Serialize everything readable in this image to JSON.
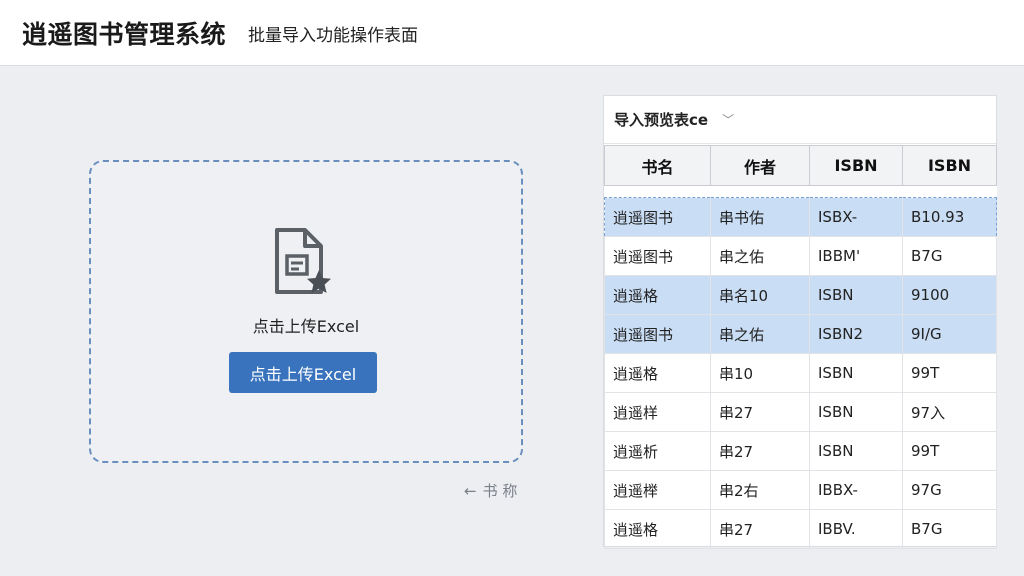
{
  "header": {
    "app_title": "逍遥图书管理系统",
    "page_subtitle": "批量导入功能操作表面"
  },
  "upload": {
    "instruction": "点击上传Excel",
    "button_label": "点击上传Excel",
    "back_hint": "书 称",
    "icon": "document-star-icon"
  },
  "preview": {
    "select_label": "导入预览表ce",
    "columns": [
      "书名",
      "作者",
      "ISBN",
      "ISBN"
    ],
    "rows": [
      [
        "逍遥图书",
        "串书佑",
        "ISBX-",
        "B10.93"
      ],
      [
        "逍遥图书",
        "串之佑",
        "IBBM'",
        "B7G"
      ],
      [
        "逍遥格",
        "串名10",
        "ISBN",
        "9100"
      ],
      [
        "逍遥图书",
        "串之佑",
        "ISBN2",
        "9I/G"
      ],
      [
        "逍遥格",
        "串10",
        "ISBN",
        "99T"
      ],
      [
        "逍遥样",
        "串27",
        "ISBN",
        "97入"
      ],
      [
        "逍遥析",
        "串27",
        "ISBN",
        "99T"
      ],
      [
        "逍遥榉",
        "串2右",
        "IBBX-",
        "97G"
      ],
      [
        "逍遥格",
        "串27",
        "IBBV.",
        "B7G"
      ]
    ]
  },
  "colors": {
    "accent": "#3a73bd",
    "row_highlight": "#c9ddf4",
    "dashed_border": "#6a8fbf"
  }
}
